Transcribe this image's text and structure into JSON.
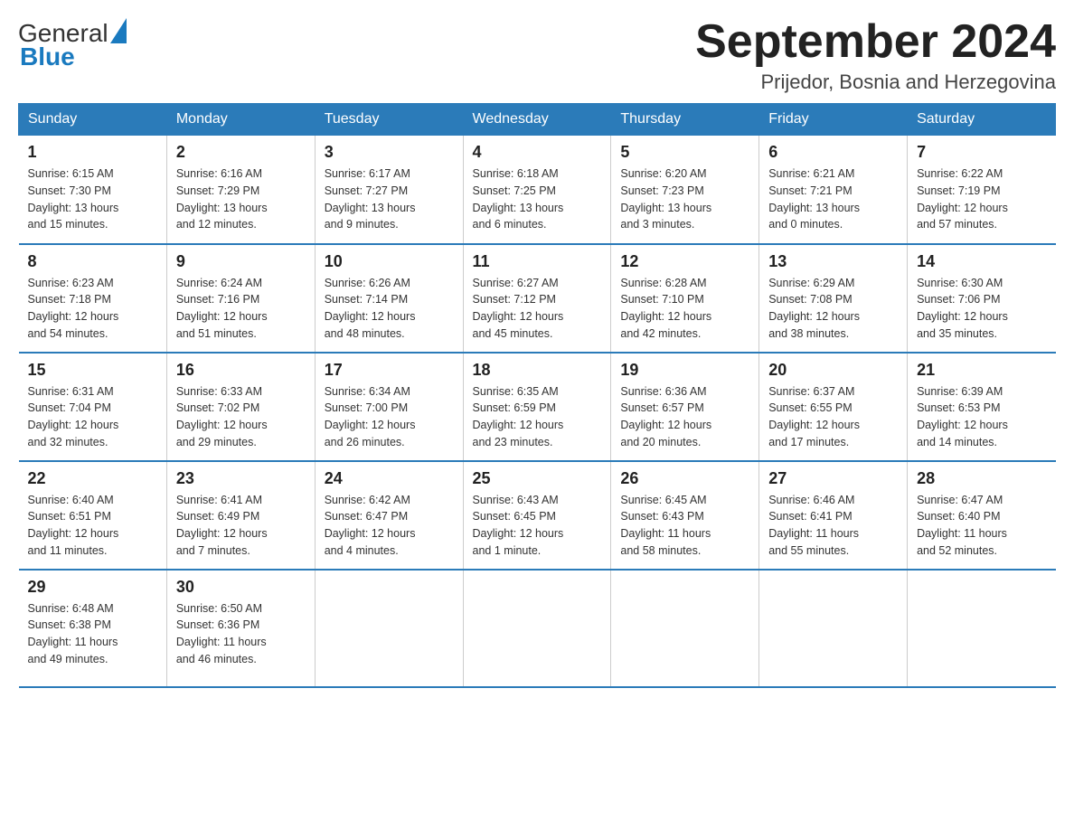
{
  "header": {
    "logo_general": "General",
    "logo_blue": "Blue",
    "month_title": "September 2024",
    "location": "Prijedor, Bosnia and Herzegovina"
  },
  "days_of_week": [
    "Sunday",
    "Monday",
    "Tuesday",
    "Wednesday",
    "Thursday",
    "Friday",
    "Saturday"
  ],
  "weeks": [
    [
      {
        "day": "1",
        "info": "Sunrise: 6:15 AM\nSunset: 7:30 PM\nDaylight: 13 hours\nand 15 minutes."
      },
      {
        "day": "2",
        "info": "Sunrise: 6:16 AM\nSunset: 7:29 PM\nDaylight: 13 hours\nand 12 minutes."
      },
      {
        "day": "3",
        "info": "Sunrise: 6:17 AM\nSunset: 7:27 PM\nDaylight: 13 hours\nand 9 minutes."
      },
      {
        "day": "4",
        "info": "Sunrise: 6:18 AM\nSunset: 7:25 PM\nDaylight: 13 hours\nand 6 minutes."
      },
      {
        "day": "5",
        "info": "Sunrise: 6:20 AM\nSunset: 7:23 PM\nDaylight: 13 hours\nand 3 minutes."
      },
      {
        "day": "6",
        "info": "Sunrise: 6:21 AM\nSunset: 7:21 PM\nDaylight: 13 hours\nand 0 minutes."
      },
      {
        "day": "7",
        "info": "Sunrise: 6:22 AM\nSunset: 7:19 PM\nDaylight: 12 hours\nand 57 minutes."
      }
    ],
    [
      {
        "day": "8",
        "info": "Sunrise: 6:23 AM\nSunset: 7:18 PM\nDaylight: 12 hours\nand 54 minutes."
      },
      {
        "day": "9",
        "info": "Sunrise: 6:24 AM\nSunset: 7:16 PM\nDaylight: 12 hours\nand 51 minutes."
      },
      {
        "day": "10",
        "info": "Sunrise: 6:26 AM\nSunset: 7:14 PM\nDaylight: 12 hours\nand 48 minutes."
      },
      {
        "day": "11",
        "info": "Sunrise: 6:27 AM\nSunset: 7:12 PM\nDaylight: 12 hours\nand 45 minutes."
      },
      {
        "day": "12",
        "info": "Sunrise: 6:28 AM\nSunset: 7:10 PM\nDaylight: 12 hours\nand 42 minutes."
      },
      {
        "day": "13",
        "info": "Sunrise: 6:29 AM\nSunset: 7:08 PM\nDaylight: 12 hours\nand 38 minutes."
      },
      {
        "day": "14",
        "info": "Sunrise: 6:30 AM\nSunset: 7:06 PM\nDaylight: 12 hours\nand 35 minutes."
      }
    ],
    [
      {
        "day": "15",
        "info": "Sunrise: 6:31 AM\nSunset: 7:04 PM\nDaylight: 12 hours\nand 32 minutes."
      },
      {
        "day": "16",
        "info": "Sunrise: 6:33 AM\nSunset: 7:02 PM\nDaylight: 12 hours\nand 29 minutes."
      },
      {
        "day": "17",
        "info": "Sunrise: 6:34 AM\nSunset: 7:00 PM\nDaylight: 12 hours\nand 26 minutes."
      },
      {
        "day": "18",
        "info": "Sunrise: 6:35 AM\nSunset: 6:59 PM\nDaylight: 12 hours\nand 23 minutes."
      },
      {
        "day": "19",
        "info": "Sunrise: 6:36 AM\nSunset: 6:57 PM\nDaylight: 12 hours\nand 20 minutes."
      },
      {
        "day": "20",
        "info": "Sunrise: 6:37 AM\nSunset: 6:55 PM\nDaylight: 12 hours\nand 17 minutes."
      },
      {
        "day": "21",
        "info": "Sunrise: 6:39 AM\nSunset: 6:53 PM\nDaylight: 12 hours\nand 14 minutes."
      }
    ],
    [
      {
        "day": "22",
        "info": "Sunrise: 6:40 AM\nSunset: 6:51 PM\nDaylight: 12 hours\nand 11 minutes."
      },
      {
        "day": "23",
        "info": "Sunrise: 6:41 AM\nSunset: 6:49 PM\nDaylight: 12 hours\nand 7 minutes."
      },
      {
        "day": "24",
        "info": "Sunrise: 6:42 AM\nSunset: 6:47 PM\nDaylight: 12 hours\nand 4 minutes."
      },
      {
        "day": "25",
        "info": "Sunrise: 6:43 AM\nSunset: 6:45 PM\nDaylight: 12 hours\nand 1 minute."
      },
      {
        "day": "26",
        "info": "Sunrise: 6:45 AM\nSunset: 6:43 PM\nDaylight: 11 hours\nand 58 minutes."
      },
      {
        "day": "27",
        "info": "Sunrise: 6:46 AM\nSunset: 6:41 PM\nDaylight: 11 hours\nand 55 minutes."
      },
      {
        "day": "28",
        "info": "Sunrise: 6:47 AM\nSunset: 6:40 PM\nDaylight: 11 hours\nand 52 minutes."
      }
    ],
    [
      {
        "day": "29",
        "info": "Sunrise: 6:48 AM\nSunset: 6:38 PM\nDaylight: 11 hours\nand 49 minutes."
      },
      {
        "day": "30",
        "info": "Sunrise: 6:50 AM\nSunset: 6:36 PM\nDaylight: 11 hours\nand 46 minutes."
      },
      {
        "day": "",
        "info": ""
      },
      {
        "day": "",
        "info": ""
      },
      {
        "day": "",
        "info": ""
      },
      {
        "day": "",
        "info": ""
      },
      {
        "day": "",
        "info": ""
      }
    ]
  ]
}
